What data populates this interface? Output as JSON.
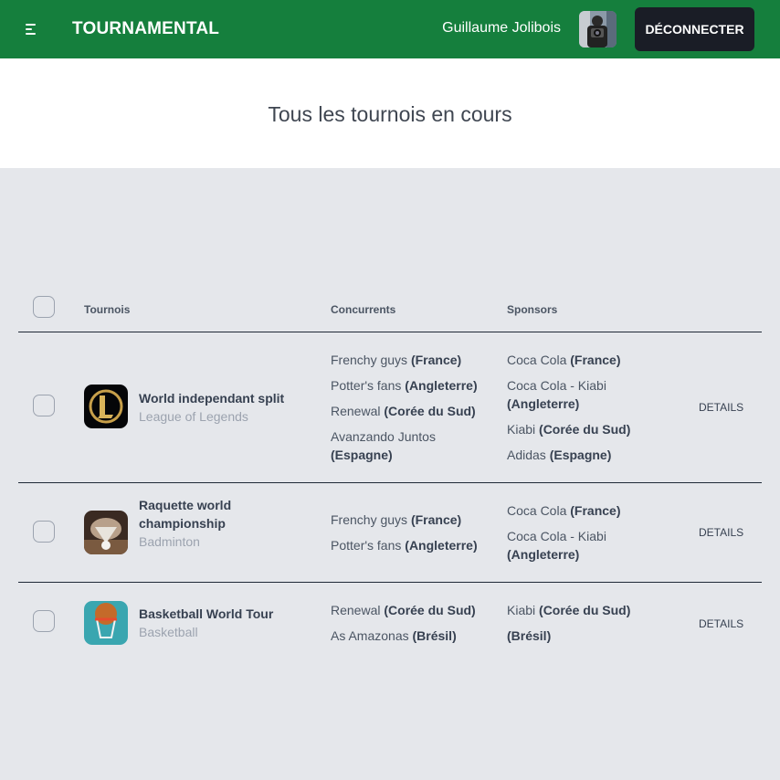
{
  "app": {
    "brand": "TOURNAMENTAL",
    "user_name": "Guillaume Jolibois",
    "logout_label": "DÉCONNECTER"
  },
  "page": {
    "title": "Tous les tournois en cours"
  },
  "table": {
    "columns": [
      "Tournois",
      "Concurrents",
      "Sponsors"
    ],
    "rows": [
      {
        "name": "World independant split",
        "game": "League of Legends",
        "logo_icon": "league-of-legends-logo",
        "competitors": [
          {
            "name": "Frenchy guys",
            "country": "(France)"
          },
          {
            "name": "Potter's fans",
            "country": "(Angleterre)"
          },
          {
            "name": "Renewal",
            "country": "(Corée du Sud)"
          },
          {
            "name": "Avanzando Juntos",
            "country": "(Espagne)"
          }
        ],
        "sponsors": [
          {
            "name": "Coca Cola",
            "country": "(France)"
          },
          {
            "name": "Coca Cola - Kiabi",
            "country": "(Angleterre)"
          },
          {
            "name": "Kiabi",
            "country": "(Corée du Sud)"
          },
          {
            "name": "Adidas",
            "country": "(Espagne)"
          }
        ],
        "details_label": "DETAILS"
      },
      {
        "name": "Raquette world championship",
        "game": "Badminton",
        "logo_icon": "badminton-shuttlecock-image",
        "competitors": [
          {
            "name": "Frenchy guys",
            "country": "(France)"
          },
          {
            "name": "Potter's fans",
            "country": "(Angleterre)"
          }
        ],
        "sponsors": [
          {
            "name": "Coca Cola",
            "country": "(France)"
          },
          {
            "name": "Coca Cola - Kiabi",
            "country": "(Angleterre)"
          }
        ],
        "details_label": "DETAILS"
      },
      {
        "name": "Basketball World Tour",
        "game": "Basketball",
        "logo_icon": "basketball-hoop-image",
        "competitors": [
          {
            "name": "Renewal",
            "country": "(Corée du Sud)"
          },
          {
            "name": "As Amazonas",
            "country": "(Brésil)"
          }
        ],
        "sponsors": [
          {
            "name": "Kiabi",
            "country": "(Corée du Sud)"
          },
          {
            "name": "",
            "country": "(Brésil)"
          }
        ],
        "details_label": "DETAILS"
      }
    ]
  },
  "colors": {
    "navbar": "#157f3d",
    "logout_button": "#1a1d26",
    "page_background": "#e5e7eb"
  }
}
